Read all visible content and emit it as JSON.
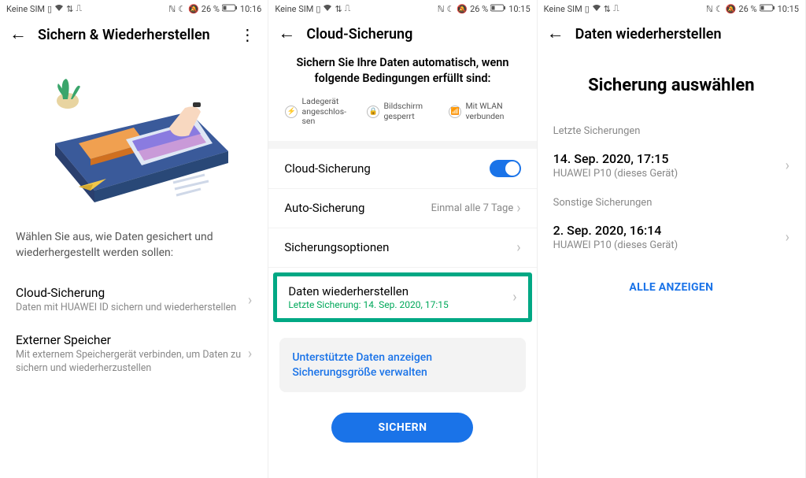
{
  "status": {
    "sim": "Keine SIM",
    "battery": "26 %",
    "time1": "10:16",
    "time2": "10:15",
    "time3": "10:15"
  },
  "screen1": {
    "title": "Sichern & Wiederherstellen",
    "intro": "Wählen Sie aus, wie Daten gesichert und wiederhergestellt werden sollen:",
    "opt1_title": "Cloud-Sicherung",
    "opt1_sub": "Daten mit HUAWEI ID sichern und wiederherstellen",
    "opt2_title": "Externer Speicher",
    "opt2_sub": "Mit externem Speichergerät verbinden, um Daten zu sichern und wiederherzustellen"
  },
  "screen2": {
    "title": "Cloud-Sicherung",
    "instr": "Sichern Sie Ihre Daten automatisch, wenn folgende Bedingungen erfüllt sind:",
    "cond1": "Ladegerät angeschlos-sen",
    "cond2": "Bildschirm gesperrt",
    "cond3": "Mit WLAN verbunden",
    "row_cloud": "Cloud-Sicherung",
    "row_auto": "Auto-Sicherung",
    "row_auto_val": "Einmal alle 7 Tage",
    "row_options": "Sicherungsoptionen",
    "row_restore": "Daten wiederherstellen",
    "row_restore_sub": "Letzte Sicherung: 14. Sep. 2020, 17:15",
    "link1": "Unterstützte Daten anzeigen",
    "link2": "Sicherungsgröße verwalten",
    "btn": "SICHERN"
  },
  "screen3": {
    "title": "Daten wiederherstellen",
    "big": "Sicherung auswählen",
    "sec1": "Letzte Sicherungen",
    "b1_date": "14. Sep. 2020, 17:15",
    "b1_dev": "HUAWEI P10 (dieses Gerät)",
    "sec2": "Sonstige Sicherungen",
    "b2_date": "2. Sep. 2020, 16:14",
    "b2_dev": "HUAWEI P10 (dieses Gerät)",
    "show_all": "ALLE ANZEIGEN"
  }
}
